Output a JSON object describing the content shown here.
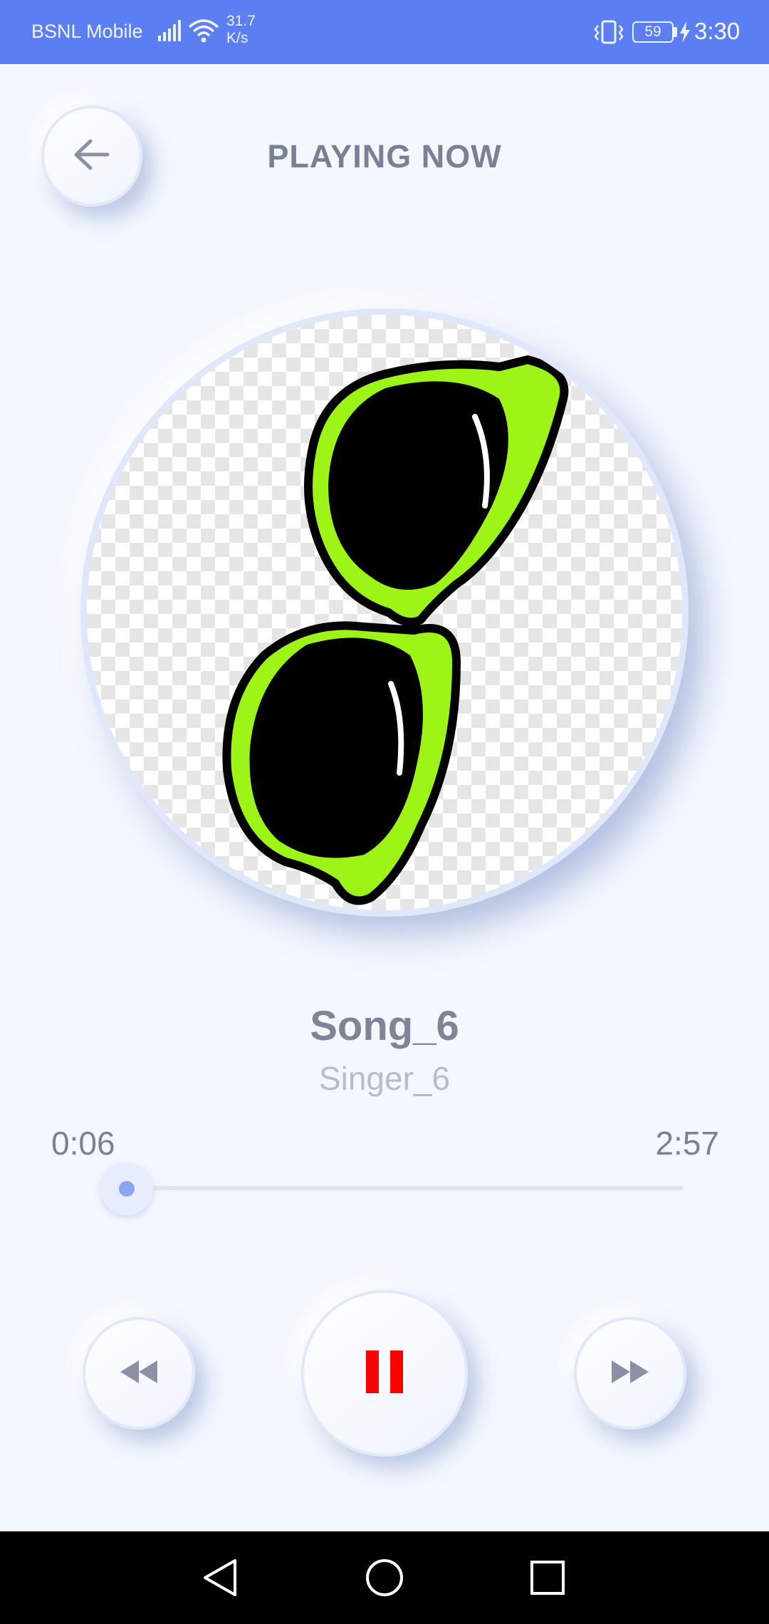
{
  "status_bar": {
    "carrier": "BSNL Mobile",
    "network_speed_value": "31.7",
    "network_speed_unit": "K/s",
    "battery_level": "59",
    "time": "3:30",
    "icons": [
      "signal-icon",
      "wifi-icon",
      "vibrate-icon",
      "battery-icon",
      "charging-icon"
    ]
  },
  "header": {
    "back_icon": "arrow-left-icon",
    "title": "PLAYING NOW"
  },
  "album_art": {
    "description_icon": "sunglasses-artwork",
    "frame_color": "#9cf516"
  },
  "track": {
    "title": "Song_6",
    "artist": "Singer_6"
  },
  "progress": {
    "elapsed": "0:06",
    "duration": "2:57",
    "fraction": 0.034
  },
  "controls": {
    "rewind_icon": "rewind-icon",
    "play_pause_icon": "pause-icon",
    "forward_icon": "fast-forward-icon",
    "pause_color": "#ff0000"
  },
  "nav_bar": {
    "items": [
      "back-nav-icon",
      "home-nav-icon",
      "recents-nav-icon"
    ]
  },
  "colors": {
    "status_bar": "#5b7ff2",
    "background": "#f3f7fe",
    "accent": "#8ba6f1"
  }
}
